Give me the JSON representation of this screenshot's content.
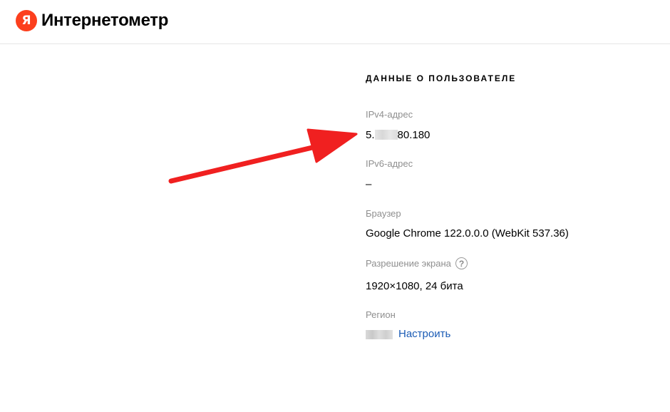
{
  "header": {
    "logo_letter": "Я",
    "logo_text": "Интернетометр"
  },
  "user_data": {
    "title": "ДАННЫЕ О ПОЛЬЗОВАТЕЛЕ",
    "ipv4": {
      "label": "IPv4-адрес",
      "value_prefix": "5.",
      "value_suffix": "80.180"
    },
    "ipv6": {
      "label": "IPv6-адрес",
      "value": "–"
    },
    "browser": {
      "label": "Браузер",
      "value": "Google Chrome 122.0.0.0 (WebKit 537.36)"
    },
    "screen": {
      "label": "Разрешение экрана",
      "help": "?",
      "value": "1920×1080, 24 бита"
    },
    "region": {
      "label": "Регион",
      "link": "Настроить"
    }
  },
  "colors": {
    "brand": "#fc3f1d",
    "link": "#1a5bb5",
    "annotation_arrow": "#f02020",
    "label": "#8f8f8f"
  }
}
